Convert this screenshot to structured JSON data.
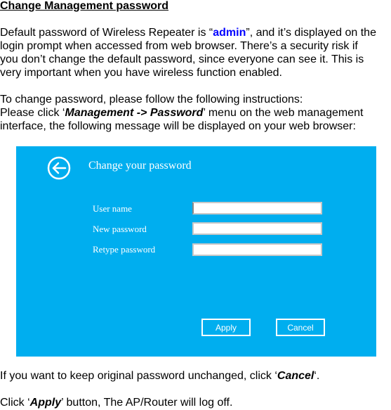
{
  "heading": "Change Management password",
  "intro": {
    "line1_a": "Default password of Wireless Repeater is “",
    "line1_admin": "admin",
    "line1_b": "”, and it’s displayed on the",
    "line2": "login prompt when accessed from web browser. There’s a security risk if",
    "line3": "you don’t change the default password, since everyone can see it. This is",
    "line4": "very important when you have wireless function enabled."
  },
  "instructions": {
    "line1": "To change password, please follow the following instructions:",
    "line2_a": "Please click ‘",
    "line2_em": "Management -> Password",
    "line2_b": "’ menu on the web management",
    "line3": "interface, the following message will be displayed on your web browser:"
  },
  "panel": {
    "background_color": "#00aeef",
    "back_icon": "arrow-left-circle-icon",
    "title": "Change your password",
    "fields": [
      {
        "label": "User name",
        "value": ""
      },
      {
        "label": "New password",
        "value": ""
      },
      {
        "label": "Retype password",
        "value": ""
      }
    ],
    "apply_label": "Apply",
    "cancel_label": "Cancel"
  },
  "note_cancel": {
    "a": "If you want to keep original password unchanged, click ‘",
    "em": "Cancel",
    "b": "‘."
  },
  "note_apply": {
    "a": "Click ‘",
    "em": "Apply",
    "b": "’ button, The AP/Router will log off."
  },
  "colors": {
    "link_blue": "#0000ff",
    "panel_blue": "#00aeef"
  }
}
